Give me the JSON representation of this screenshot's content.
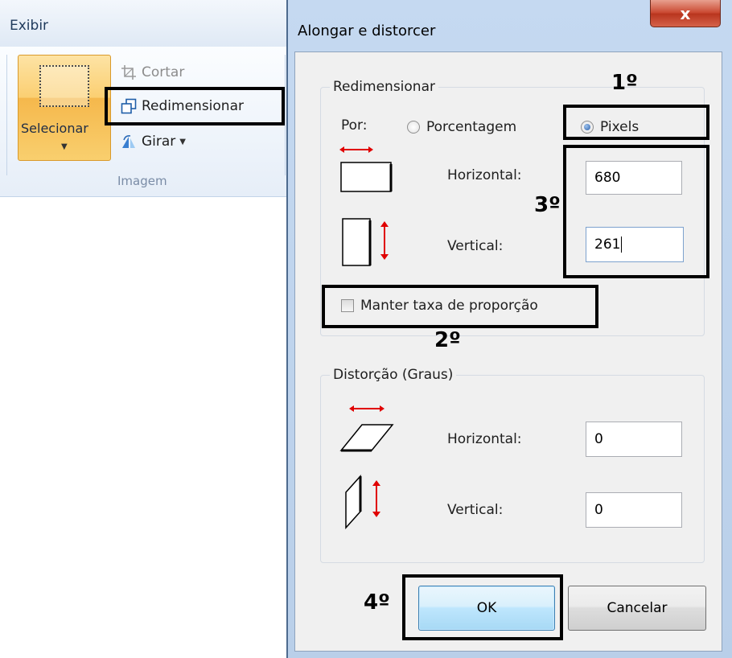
{
  "ribbon": {
    "tab_label": "Exibir",
    "select_label": "Selecionar",
    "crop_label": "Cortar",
    "resize_label": "Redimensionar",
    "rotate_label": "Girar",
    "group_label": "Imagem"
  },
  "dialog": {
    "title": "Alongar e distorcer",
    "close_glyph": "x",
    "resize": {
      "legend": "Redimensionar",
      "by_label": "Por:",
      "option_percent": "Porcentagem",
      "option_pixels": "Pixels",
      "selected_option": "Pixels",
      "horizontal_label": "Horizontal:",
      "horizontal_value": "680",
      "vertical_label": "Vertical:",
      "vertical_value": "261",
      "keep_ratio_label": "Manter taxa de proporção",
      "keep_ratio_checked": false
    },
    "skew": {
      "legend": "Distorção (Graus)",
      "horizontal_label": "Horizontal:",
      "horizontal_value": "0",
      "vertical_label": "Vertical:",
      "vertical_value": "0"
    },
    "ok_label": "OK",
    "cancel_label": "Cancelar"
  },
  "annotations": {
    "step1": "1º",
    "step2": "2º",
    "step3": "3º",
    "step4": "4º"
  },
  "colors": {
    "annotation_outline": "#000000",
    "arrow_red": "#e00000",
    "select_button": "#fbcf72",
    "close_button": "#c8452d"
  }
}
